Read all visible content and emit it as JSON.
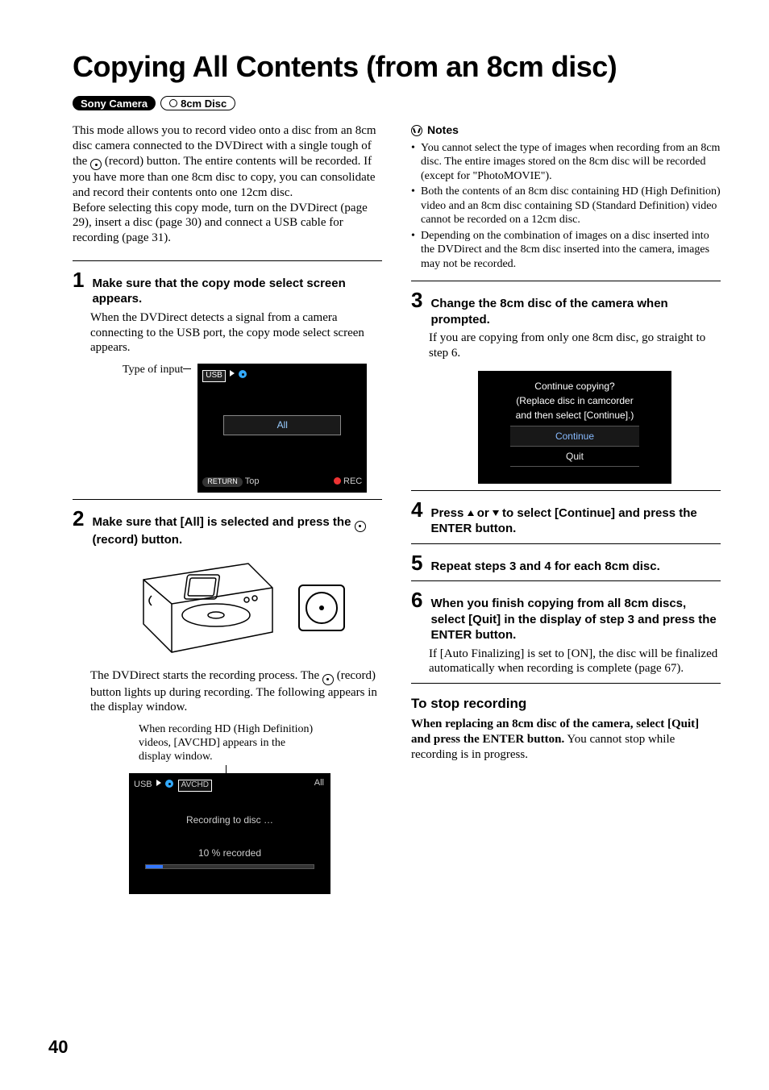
{
  "page": {
    "number": "40"
  },
  "title": "Copying All Contents (from an 8cm disc)",
  "badges": {
    "camera": "Sony Camera",
    "disc": "8cm Disc"
  },
  "intro": {
    "p1a": "This mode allows you to record video onto a disc from an 8cm disc camera connected to the DVDirect with a single tough of the ",
    "p1b": " (record) button. The entire contents will be recorded. If you have more than one 8cm disc to copy, you can consolidate and record their contents onto one 12cm disc.",
    "p2": "Before selecting this copy mode, turn on the DVDirect (page 29), insert a disc (page 30) and connect a USB cable for recording (page 31)."
  },
  "steps": {
    "s1": {
      "num": "1",
      "title": "Make sure that the copy mode select screen appears.",
      "body": "When the DVDirect detects a signal from a camera connecting to the USB port, the copy mode select screen appears.",
      "label": "Type of input"
    },
    "s2": {
      "num": "2",
      "title_a": "Make sure that [All] is selected and press the ",
      "title_b": " (record) button.",
      "body_a": "The DVDirect starts the recording process. The ",
      "body_b": " (record) button lights up during recording. The following appears in the display window.",
      "caption": "When recording HD (High Definition) videos, [AVCHD] appears in the display window."
    },
    "s3": {
      "num": "3",
      "title": "Change the 8cm disc of the camera when prompted.",
      "body": "If you are copying from only one 8cm disc, go straight to step 6."
    },
    "s4": {
      "num": "4",
      "title_a": "Press ",
      "title_mid": " or ",
      "title_b": " to select [Continue] and press the ENTER button."
    },
    "s5": {
      "num": "5",
      "title": "Repeat steps 3 and 4 for each 8cm disc."
    },
    "s6": {
      "num": "6",
      "title": "When you finish copying from all 8cm discs, select [Quit] in the display of step 3 and press the ENTER button.",
      "body": "If [Auto Finalizing] is set to [ON], the disc will be finalized automatically when recording is complete (page 67)."
    }
  },
  "notes": {
    "head": "Notes",
    "items": [
      "You cannot select the type of images when recording from an 8cm disc. The entire images stored on the 8cm disc will be recorded (except for \"PhotoMOVIE\").",
      "Both the contents of an 8cm disc containing HD (High Definition) video and an 8cm disc containing SD (Standard Definition) video cannot be recorded on a 12cm disc.",
      "Depending on the combination of images on a disc inserted into the DVDirect and the 8cm disc inserted into the camera, images may not be recorded."
    ]
  },
  "stop": {
    "head": "To stop recording",
    "bold": "When replacing an 8cm disc of the camera, select [Quit] and press the ENTER button.",
    "body": "You cannot stop while recording is in progress."
  },
  "screen1": {
    "usb": "USB",
    "all": "All",
    "return": "RETURN",
    "top": "Top",
    "rec": "REC"
  },
  "screen2": {
    "usb": "USB",
    "avchd": "AVCHD",
    "all": "All",
    "recording": "Recording to disc …",
    "pct": "10 % recorded"
  },
  "screen3": {
    "q": "Continue copying?",
    "l2": "(Replace disc in camcorder",
    "l3": "and then select [Continue].)",
    "cont": "Continue",
    "quit": "Quit"
  }
}
